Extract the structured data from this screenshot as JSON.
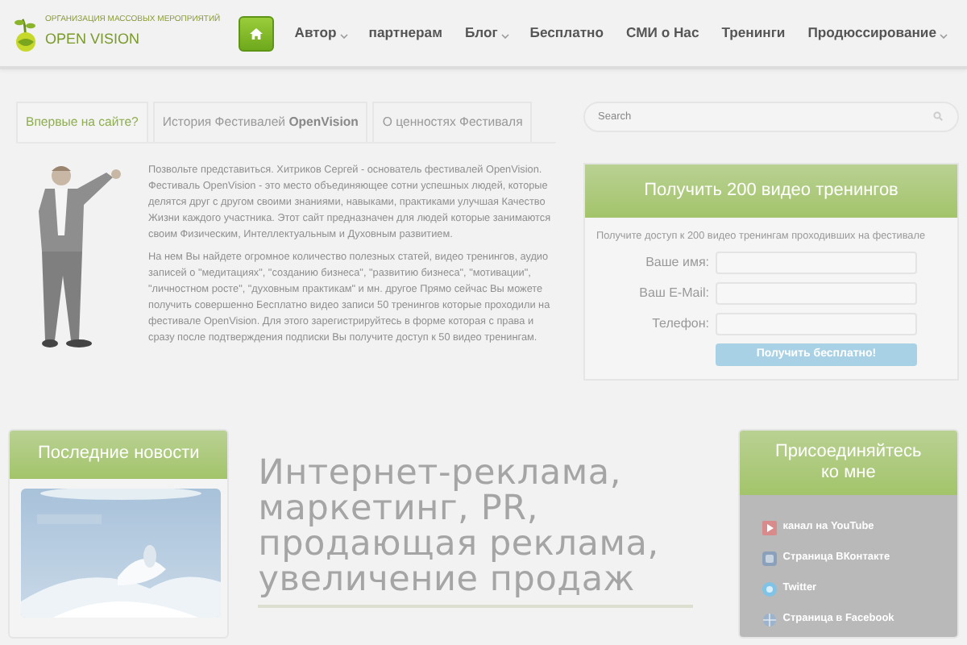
{
  "logo": {
    "tagline": "ОРГАНИЗАЦИЯ МАССОВЫХ МЕРОПРИЯТИЙ",
    "name": "OPEN VISION"
  },
  "nav": [
    {
      "kind": "home",
      "selected": true
    },
    {
      "kind": "link",
      "label": "Автор",
      "dropdown": true,
      "selected": false
    },
    {
      "kind": "link",
      "label": "партнерам",
      "dropdown": false,
      "selected": false
    },
    {
      "kind": "link",
      "label": "Блог",
      "dropdown": true,
      "selected": false
    },
    {
      "kind": "link",
      "label": "Бесплатно",
      "dropdown": false,
      "selected": false
    },
    {
      "kind": "link",
      "label": "СМИ о Нас",
      "dropdown": false,
      "selected": false
    },
    {
      "kind": "link",
      "label": "Тренинги",
      "dropdown": false,
      "selected": false
    },
    {
      "kind": "link",
      "label": "Продюссирование",
      "dropdown": true,
      "selected": false
    }
  ],
  "tabs": [
    {
      "label": "Впервые на сайте?",
      "selected": true
    },
    {
      "label": "История Фестивалей **OpenVision**",
      "selected": false
    },
    {
      "label": "О ценностях Фестиваля",
      "selected": false
    }
  ],
  "intro": [
    "Позвольте представиться. Хитриков Сергей - основатель фестивалей OpenVision. Фестиваль OpenVision - это место объединяющее сотни успешных людей, которые делятся друг с другом своими знаниями, навыками, практиками улучшая Качество Жизни каждого участника. Этот сайт предназначен для людей которые занимаются своим Физическим, Интеллектуальным и Духовным развитием.",
    "На нем Вы найдете огромное количество полезных статей, видео тренингов, аудио записей о \"медитациях\", \"созданию бизнеса\", \"развитию бизнеса\", \"мотивации\", \"личностном росте\", \"духовным практикам\" и мн. другое Прямо сейчас Вы можете получить совершенно Бесплатно видео записи 50 тренингов которые проходили на фестивале OpenVision. Для этого зарегистрируйтесь в форме которая с права и сразу после подтверждения подписки Вы получите доступ к 50 видео тренингам."
  ],
  "search": {
    "placeholder": "Search"
  },
  "signup": {
    "title": "Получить 200 видео тренингов",
    "subtitle": "Получите доступ к 200 видео тренингам проходивших на фестивале",
    "fields": [
      {
        "label": "Ваше имя:"
      },
      {
        "label": "Ваш E-Mail:"
      },
      {
        "label": "Телефон:"
      }
    ],
    "button": "Получить бесплатно!"
  },
  "news": {
    "title": "Последние новости"
  },
  "article": {
    "title": "Интернет-реклама, маркетинг, PR, продающая реклама, увеличение продаж"
  },
  "social": {
    "title": "Присоединяйтесь ко мне",
    "links": [
      {
        "kind": "youtube",
        "label": "канал на YouTube"
      },
      {
        "kind": "vk",
        "label": "Страница ВКонтакте"
      },
      {
        "kind": "twitter",
        "label": "Twitter"
      },
      {
        "kind": "facebook",
        "label": "Страница в Facebook"
      }
    ]
  }
}
